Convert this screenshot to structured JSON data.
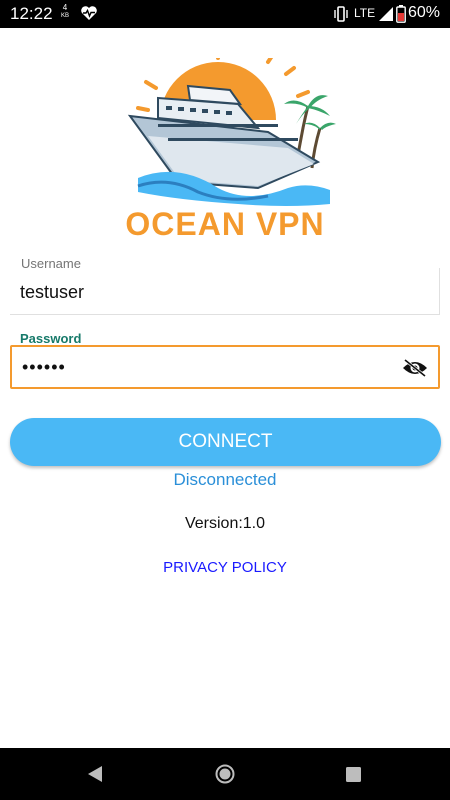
{
  "status_bar": {
    "time": "12:22",
    "data_amount": "4",
    "data_unit": "KB",
    "network": "LTE",
    "battery_percent": "60%"
  },
  "app": {
    "brand_name": "OCEAN VPN",
    "logo_icon": "cruise-ship-sunset-logo"
  },
  "form": {
    "username_label": "Username",
    "username_value": "testuser",
    "password_label": "Password",
    "password_value": "••••••",
    "toggle_visibility_icon": "eye-off-icon"
  },
  "actions": {
    "connect_label": "CONNECT",
    "connection_status": "Disconnected",
    "version_text": "Version:1.0",
    "privacy_link": "PRIVACY POLICY"
  },
  "colors": {
    "accent_orange": "#f49a2e",
    "button_blue": "#4ab8f5",
    "status_blue": "#2a8fd8",
    "link_blue": "#1a1aff",
    "password_label_teal": "#177a6a"
  },
  "nav_bar": {
    "icons": [
      "back-icon",
      "home-icon",
      "recent-apps-icon"
    ]
  }
}
